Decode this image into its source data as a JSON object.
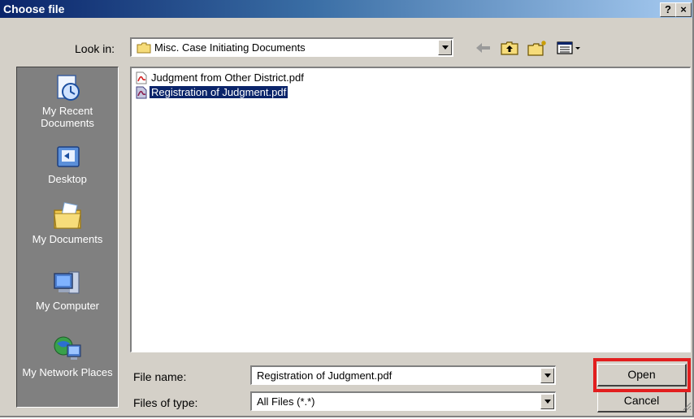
{
  "window": {
    "title": "Choose file",
    "help_label": "?",
    "close_label": "×"
  },
  "lookin": {
    "label": "Look in:",
    "value": "Misc. Case Initiating Documents"
  },
  "toolbar": {
    "icons": [
      "back-icon",
      "up-folder-icon",
      "new-folder-icon",
      "views-menu-icon"
    ]
  },
  "places": [
    {
      "label": "My Recent Documents",
      "icon": "recent-documents-icon"
    },
    {
      "label": "Desktop",
      "icon": "desktop-icon"
    },
    {
      "label": "My Documents",
      "icon": "my-documents-icon"
    },
    {
      "label": "My Computer",
      "icon": "my-computer-icon"
    },
    {
      "label": "My Network Places",
      "icon": "network-places-icon"
    }
  ],
  "files": [
    {
      "name": "Judgment from Other District.pdf",
      "selected": false
    },
    {
      "name": "Registration of Judgment.pdf",
      "selected": true
    }
  ],
  "filename": {
    "label": "File name:",
    "value": "Registration of Judgment.pdf"
  },
  "filetype": {
    "label": "Files of type:",
    "value": "All Files (*.*)"
  },
  "buttons": {
    "open": "Open",
    "cancel": "Cancel"
  },
  "colors": {
    "highlight": "#e21e1e",
    "selection": "#0a246a",
    "face": "#d4d0c8"
  }
}
